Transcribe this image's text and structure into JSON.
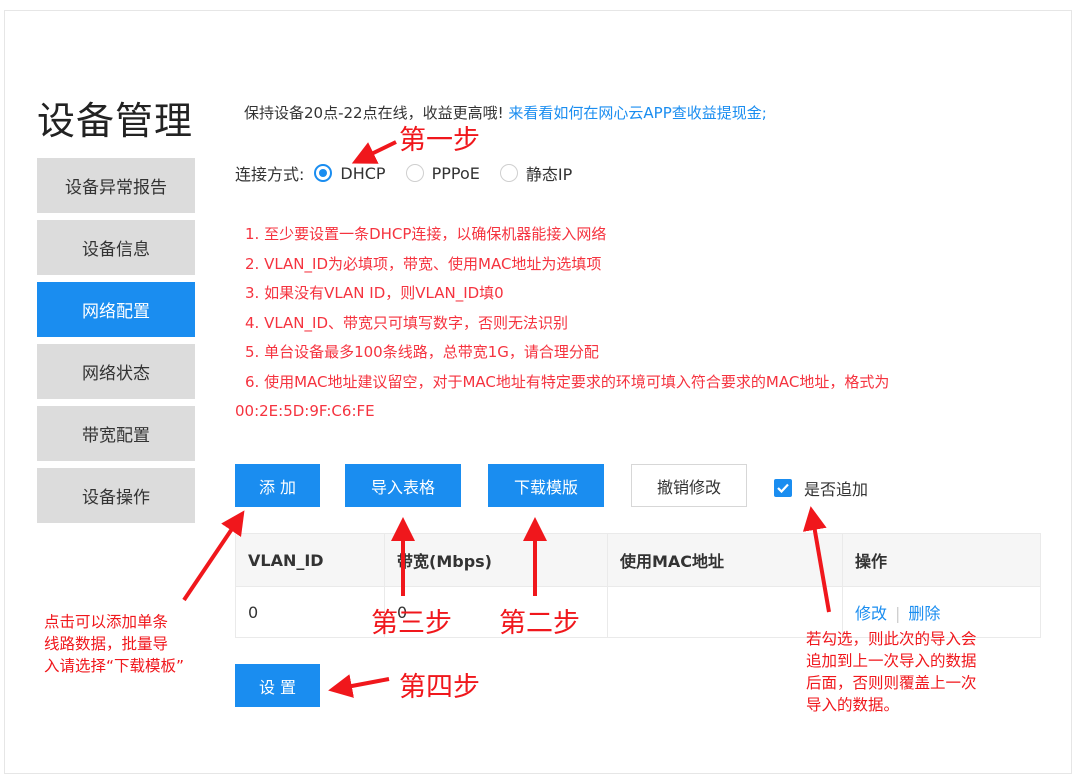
{
  "page_title": "设备管理",
  "sidebar": {
    "items": [
      {
        "label": "设备异常报告"
      },
      {
        "label": "设备信息"
      },
      {
        "label": "网络配置",
        "active": true
      },
      {
        "label": "网络状态"
      },
      {
        "label": "带宽配置"
      },
      {
        "label": "设备操作"
      }
    ]
  },
  "notice": {
    "text": "保持设备20点-22点在线，收益更高哦!",
    "link": "来看看如何在网心云APP查收益提现金;"
  },
  "connection": {
    "label": "连接方式:",
    "options": [
      {
        "label": "DHCP",
        "checked": true
      },
      {
        "label": "PPPoE",
        "checked": false
      },
      {
        "label": "静态IP",
        "checked": false
      }
    ]
  },
  "rules": [
    "1. 至少要设置一条DHCP连接，以确保机器能接入网络",
    "2. VLAN_ID为必填项，带宽、使用MAC地址为选填项",
    "3. 如果没有VLAN ID，则VLAN_ID填0",
    "4. VLAN_ID、带宽只可填写数字，否则无法识别",
    "5. 单台设备最多100条线路，总带宽1G，请合理分配",
    "6. 使用MAC地址建议留空，对于MAC地址有特定要求的环境可填入符合要求的MAC地址，格式为",
    "00:2E:5D:9F:C6:FE"
  ],
  "toolbar": {
    "add_label": "添 加",
    "import_label": "导入表格",
    "download_label": "下载模版",
    "revert_label": "撤销修改",
    "append_label": "是否追加",
    "append_checked": true
  },
  "table": {
    "headers": [
      "VLAN_ID",
      "带宽(Mbps)",
      "使用MAC地址",
      "操作"
    ],
    "rows": [
      {
        "vlan_id": "0",
        "bandwidth": "0",
        "mac": "",
        "edit": "修改",
        "delete": "删除"
      }
    ]
  },
  "set_button": "设 置",
  "annotations": {
    "step1": "第一步",
    "step2": "第二步",
    "step3": "第三步",
    "step4": "第四步",
    "add_note": [
      "点击可以添加单条",
      "线路数据，批量导",
      "入请选择“下载模板”"
    ],
    "append_note": [
      "若勾选，则此次的导入会",
      "追加到上一次导入的数据",
      "后面，否则则覆盖上一次",
      "导入的数据。"
    ]
  },
  "colors": {
    "primary": "#1a8df0",
    "annotation": "#f0171c",
    "rules_text": "#f5333f",
    "sidebar_bg": "#dcdcdc"
  }
}
